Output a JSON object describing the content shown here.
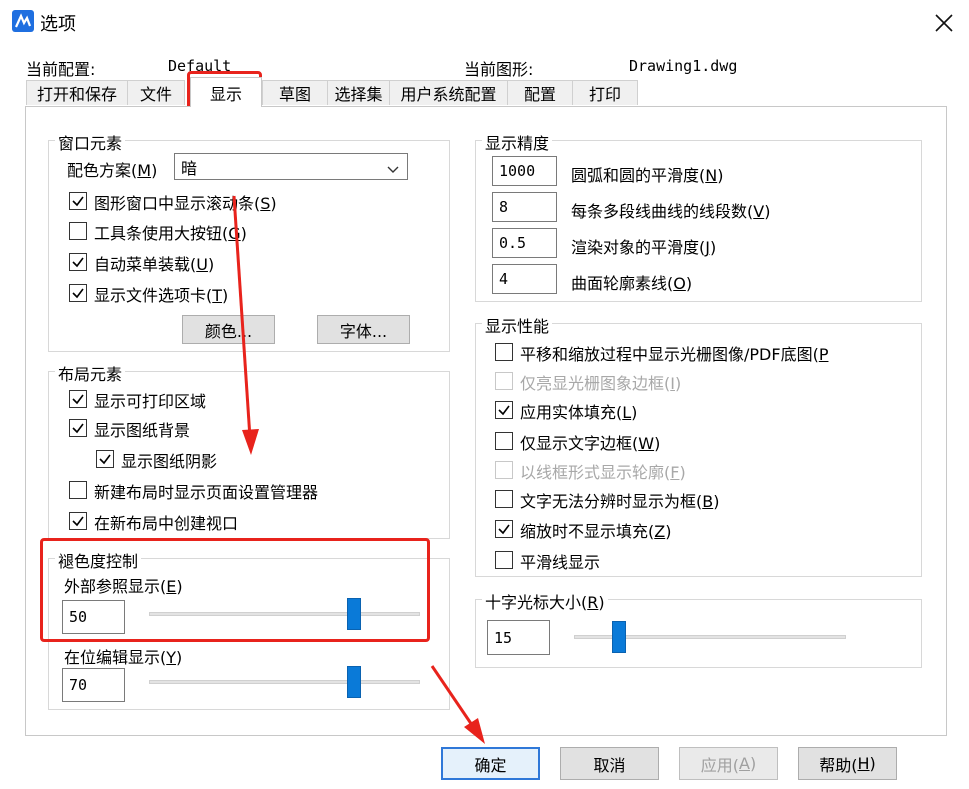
{
  "window": {
    "title": "选项",
    "close_icon": "close-icon"
  },
  "header": {
    "current_profile_label": "当前配置:",
    "current_profile_value": "Default",
    "current_drawing_label": "当前图形:",
    "current_drawing_value": "Drawing1.dwg"
  },
  "tabs": [
    "打开和保存",
    "文件",
    "显示",
    "草图",
    "选择集",
    "用户系统配置",
    "配置",
    "打印"
  ],
  "active_tab": "显示",
  "window_elements": {
    "legend": "窗口元素",
    "color_scheme_label": "配色方案(M)",
    "color_scheme_value": "暗",
    "options": [
      {
        "label": "图形窗口中显示滚动条(S)",
        "checked": true
      },
      {
        "label": "工具条使用大按钮(G)",
        "checked": false
      },
      {
        "label": "自动菜单装载(U)",
        "checked": true
      },
      {
        "label": "显示文件选项卡(T)",
        "checked": true
      }
    ],
    "colors_button": "颜色...",
    "fonts_button": "字体..."
  },
  "layout_elements": {
    "legend": "布局元素",
    "options": [
      {
        "label": "显示可打印区域",
        "checked": true
      },
      {
        "label": "显示图纸背景",
        "checked": true
      },
      {
        "label": "显示图纸阴影",
        "checked": true
      },
      {
        "label": "新建布局时显示页面设置管理器",
        "checked": false
      },
      {
        "label": "在新布局中创建视口",
        "checked": true
      }
    ]
  },
  "fade_control": {
    "legend": "褪色度控制",
    "xref_label": "外部参照显示(E)",
    "xref_value": "50",
    "xref_fraction": 0.5,
    "inplace_label": "在位编辑显示(Y)",
    "inplace_value": "70",
    "inplace_fraction": 0.7
  },
  "display_resolution": {
    "legend": "显示精度",
    "rows": [
      {
        "value": "1000",
        "label": "圆弧和圆的平滑度(N)"
      },
      {
        "value": "8",
        "label": "每条多段线曲线的线段数(V)"
      },
      {
        "value": "0.5",
        "label": "渲染对象的平滑度(J)"
      },
      {
        "value": "4",
        "label": "曲面轮廓素线(O)"
      }
    ]
  },
  "display_performance": {
    "legend": "显示性能",
    "options": [
      {
        "label": "平移和缩放过程中显示光栅图像/PDF底图(P",
        "checked": false,
        "disabled": false
      },
      {
        "label": "仅亮显光栅图象边框(I)",
        "checked": false,
        "disabled": true
      },
      {
        "label": "应用实体填充(L)",
        "checked": true,
        "disabled": false
      },
      {
        "label": "仅显示文字边框(W)",
        "checked": false,
        "disabled": false
      },
      {
        "label": "以线框形式显示轮廓(F)",
        "checked": false,
        "disabled": true
      },
      {
        "label": "文字无法分辨时显示为框(B)",
        "checked": false,
        "disabled": false
      },
      {
        "label": "缩放时不显示填充(Z)",
        "checked": true,
        "disabled": false
      },
      {
        "label": "平滑线显示",
        "checked": false,
        "disabled": false
      }
    ]
  },
  "crosshair": {
    "legend": "十字光标大小(R)",
    "value": "15",
    "fraction": 0.15
  },
  "footer": {
    "ok": "确定",
    "cancel": "取消",
    "apply": "应用(A)",
    "help": "帮助(H)"
  },
  "annotation_color": "#e8231c",
  "accent_color": "#0a7ad8"
}
